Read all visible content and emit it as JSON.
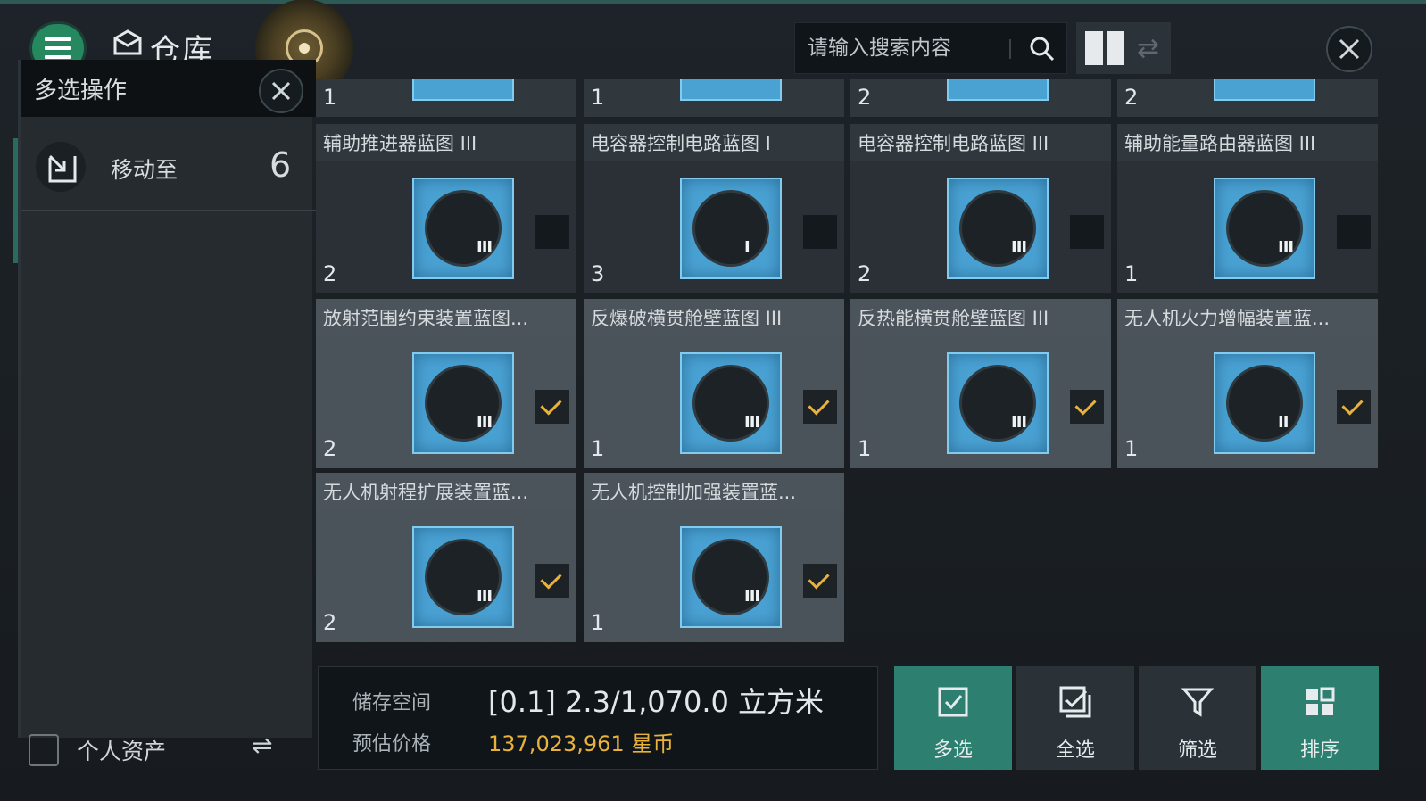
{
  "header": {
    "title": "仓库",
    "search_placeholder": "请输入搜索内容"
  },
  "left_panel": {
    "title": "多选操作",
    "move_label": "移动至",
    "move_count": "6",
    "assets_label": "个人资产"
  },
  "top_row": [
    {
      "qty": "1"
    },
    {
      "qty": "1"
    },
    {
      "qty": "2"
    },
    {
      "qty": "2"
    }
  ],
  "items": [
    {
      "name": "辅助推进器蓝图 III",
      "qty": "2",
      "tier": "III",
      "selected": false
    },
    {
      "name": "电容器控制电路蓝图 I",
      "qty": "3",
      "tier": "I",
      "selected": false
    },
    {
      "name": "电容器控制电路蓝图 III",
      "qty": "2",
      "tier": "III",
      "selected": false
    },
    {
      "name": "辅助能量路由器蓝图 III",
      "qty": "1",
      "tier": "III",
      "selected": false
    },
    {
      "name": "放射范围约束装置蓝图...",
      "qty": "2",
      "tier": "III",
      "selected": true
    },
    {
      "name": "反爆破横贯舱壁蓝图 III",
      "qty": "1",
      "tier": "III",
      "selected": true
    },
    {
      "name": "反热能横贯舱壁蓝图 III",
      "qty": "1",
      "tier": "III",
      "selected": true
    },
    {
      "name": "无人机火力增幅装置蓝...",
      "qty": "1",
      "tier": "II",
      "selected": true
    },
    {
      "name": "无人机射程扩展装置蓝...",
      "qty": "2",
      "tier": "III",
      "selected": true
    },
    {
      "name": "无人机控制加强装置蓝...",
      "qty": "1",
      "tier": "III",
      "selected": true
    }
  ],
  "footer": {
    "storage_label": "储存空间",
    "storage_value": "[0.1] 2.3/1,070.0 立方米",
    "price_label": "预估价格",
    "price_value": "137,023,961 星币"
  },
  "actions": {
    "multi_select": "多选",
    "select_all": "全选",
    "filter": "筛选",
    "sort": "排序"
  },
  "colors": {
    "accent_green": "#2d7f70",
    "check_gold": "#e8b23c",
    "icon_blue": "#4aa2d3"
  }
}
